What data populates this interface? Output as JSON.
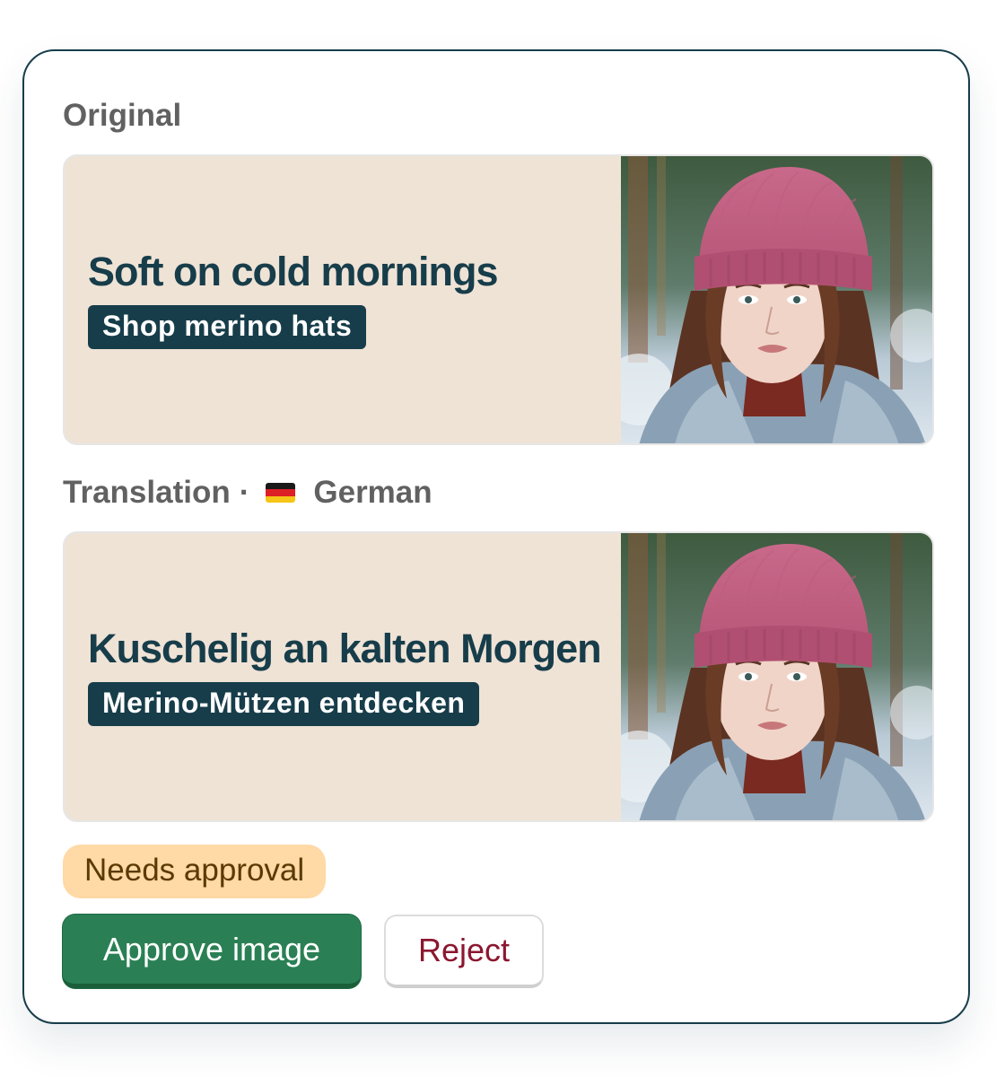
{
  "original": {
    "section_label": "Original",
    "headline": "Soft on cold mornings",
    "cta": "Shop merino hats"
  },
  "translation": {
    "section_label": "Translation",
    "separator": "·",
    "language": "German",
    "flag_icon": "germany-flag-icon",
    "headline": "Kuschelig an kalten Morgen",
    "cta": "Merino-Mützen entdecken"
  },
  "status": {
    "label": "Needs approval",
    "color": "#ffd9a6"
  },
  "actions": {
    "approve_label": "Approve image",
    "reject_label": "Reject"
  },
  "colors": {
    "brand": "#173d4a",
    "banner_bg": "#efe3d6",
    "approve": "#2a8054",
    "reject_text": "#8b1730"
  }
}
